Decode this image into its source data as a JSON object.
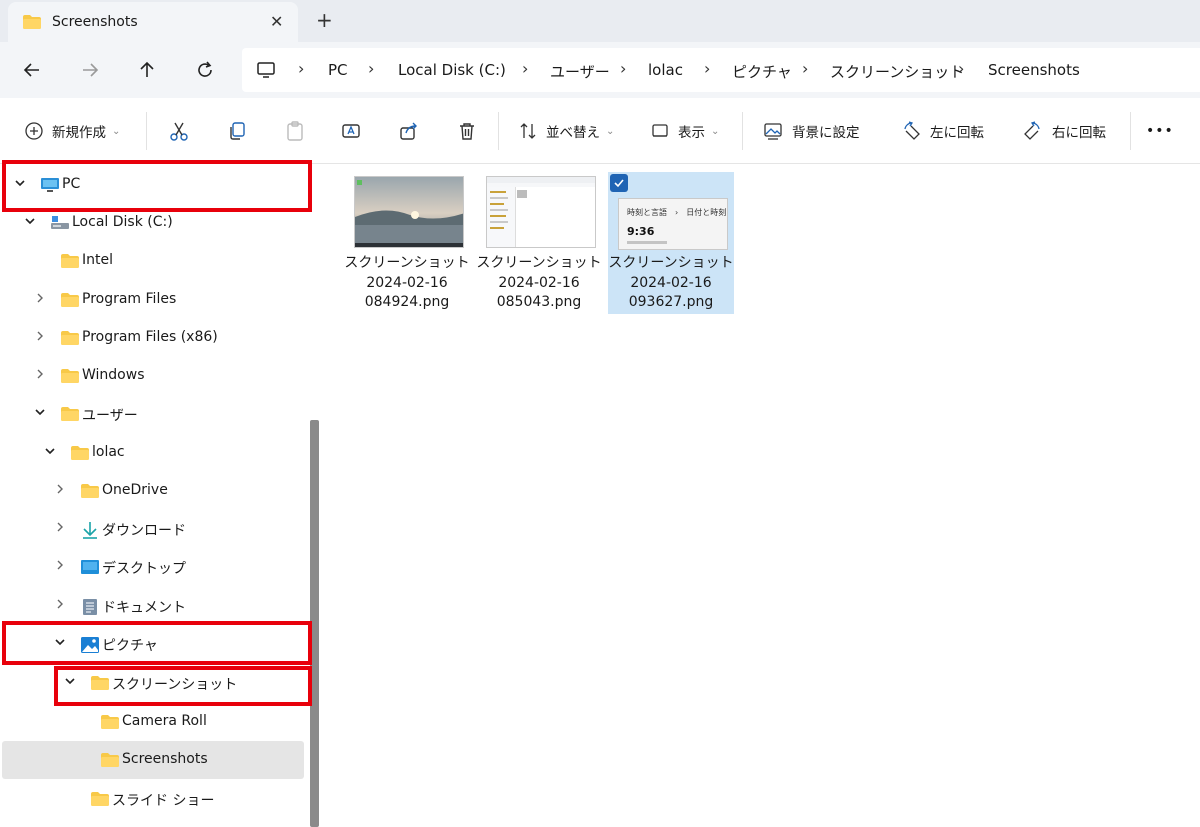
{
  "window": {
    "tab_title": "Screenshots",
    "tab_close": "✕",
    "new_tab": "+"
  },
  "nav": {
    "back": "←",
    "forward": "→",
    "up": "↑",
    "refresh": "⟳"
  },
  "breadcrumb": [
    "PC",
    "Local Disk (C:)",
    "ユーザー",
    "lolac",
    "ピクチャ",
    "スクリーンショット",
    "Screenshots"
  ],
  "toolbar": {
    "new_label": "新規作成",
    "sort_label": "並べ替え",
    "view_label": "表示",
    "set_background_label": "背景に設定",
    "rotate_left_label": "左に回転",
    "rotate_right_label": "右に回転",
    "more": "•••"
  },
  "tree": [
    {
      "label": "PC",
      "icon": "pc-icon",
      "expanded": true
    },
    {
      "label": "Local Disk (C:)",
      "icon": "drive-icon",
      "expanded": true
    },
    {
      "label": "Intel",
      "icon": "folder-icon"
    },
    {
      "label": "Program Files",
      "icon": "folder-icon",
      "expanded": false
    },
    {
      "label": "Program Files (x86)",
      "icon": "folder-icon",
      "expanded": false
    },
    {
      "label": "Windows",
      "icon": "folder-icon",
      "expanded": false
    },
    {
      "label": "ユーザー",
      "icon": "folder-icon",
      "expanded": true
    },
    {
      "label": "lolac",
      "icon": "folder-icon",
      "expanded": true
    },
    {
      "label": "OneDrive",
      "icon": "folder-icon",
      "expanded": false
    },
    {
      "label": "ダウンロード",
      "icon": "download-icon",
      "expanded": false
    },
    {
      "label": "デスクトップ",
      "icon": "desktop-icon",
      "expanded": false
    },
    {
      "label": "ドキュメント",
      "icon": "document-icon",
      "expanded": false
    },
    {
      "label": "ピクチャ",
      "icon": "pictures-icon",
      "expanded": true
    },
    {
      "label": "スクリーンショット",
      "icon": "folder-icon",
      "expanded": true
    },
    {
      "label": "Camera Roll",
      "icon": "folder-icon"
    },
    {
      "label": "Screenshots",
      "icon": "folder-icon",
      "selected": true
    },
    {
      "label": "スライド ショー",
      "icon": "folder-icon"
    }
  ],
  "files": [
    {
      "line1": "スクリーンショット",
      "line2": "2024-02-16",
      "line3": "084924.png",
      "selected": false
    },
    {
      "line1": "スクリーンショット",
      "line2": "2024-02-16",
      "line3": "085043.png",
      "selected": false
    },
    {
      "line1": "スクリーンショット",
      "line2": "2024-02-16",
      "line3": "093627.png",
      "selected": true
    }
  ],
  "thumb3": {
    "title": "時刻と言語　›　日付と時刻",
    "time": "9:36"
  },
  "colors": {
    "highlight": "#e8000b",
    "folder": "#f8c948",
    "selection": "#cce4f7",
    "accent": "#1f64b4"
  }
}
